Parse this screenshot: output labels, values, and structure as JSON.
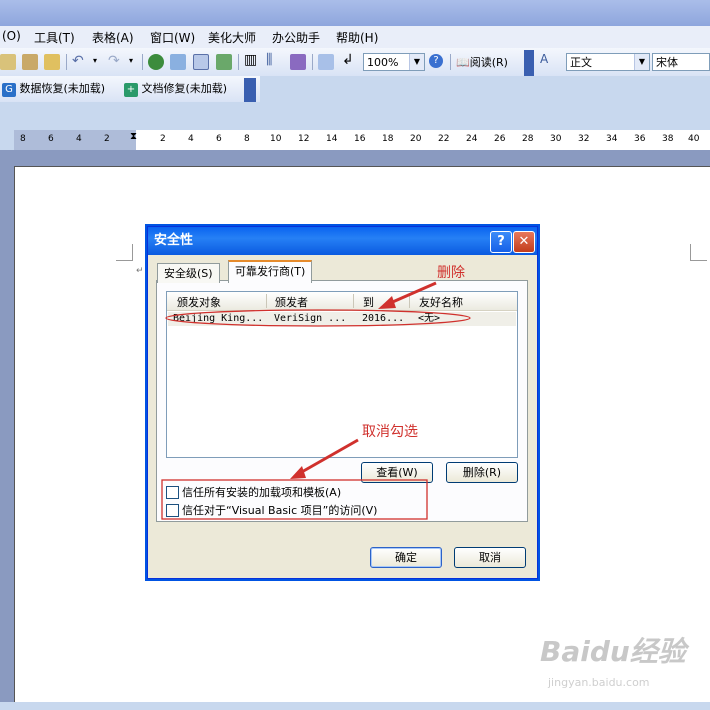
{
  "menubar": {
    "items": [
      "(O)",
      "工具(T)",
      "表格(A)",
      "窗口(W)",
      "美化大师",
      "办公助手",
      "帮助(H)"
    ]
  },
  "toolbar": {
    "zoom": "100%",
    "read_label": "阅读(R)",
    "style_value": "正文",
    "font_value": "宋体"
  },
  "addins": {
    "data_recovery": "数据恢复(未加载)",
    "doc_repair": "文档修复(未加载)"
  },
  "ruler": {
    "ticks": [
      "8",
      "6",
      "4",
      "2",
      "2",
      "4",
      "6",
      "8",
      "10",
      "12",
      "14",
      "16",
      "18",
      "20",
      "22",
      "24",
      "26",
      "28",
      "30",
      "32",
      "34",
      "36",
      "38",
      "40"
    ]
  },
  "dialog": {
    "title": "安全性",
    "tabs": [
      "安全级(S)",
      "可靠发行商(T)"
    ],
    "columns": [
      "颁发对象",
      "颁发者",
      "到",
      "友好名称"
    ],
    "rows": [
      {
        "issued_to": "Beijing King...",
        "issuer": "VeriSign ...",
        "expires": "2016...",
        "friendly": "<无>"
      }
    ],
    "view_button": "查看(W)",
    "delete_button": "删除(R)",
    "checkbox1": "信任所有安装的加载项和模板(A)",
    "checkbox2": "信任对于“Visual Basic 项目”的访问(V)",
    "checkbox1_checked": false,
    "checkbox2_checked": false,
    "ok_button": "确定",
    "cancel_button": "取消"
  },
  "annotations": {
    "delete_note": "删除",
    "uncheck_note": "取消勾选",
    "color": "#d0312d"
  },
  "watermark": {
    "text": "Baidu经验",
    "url": "jingyan.baidu.com"
  }
}
